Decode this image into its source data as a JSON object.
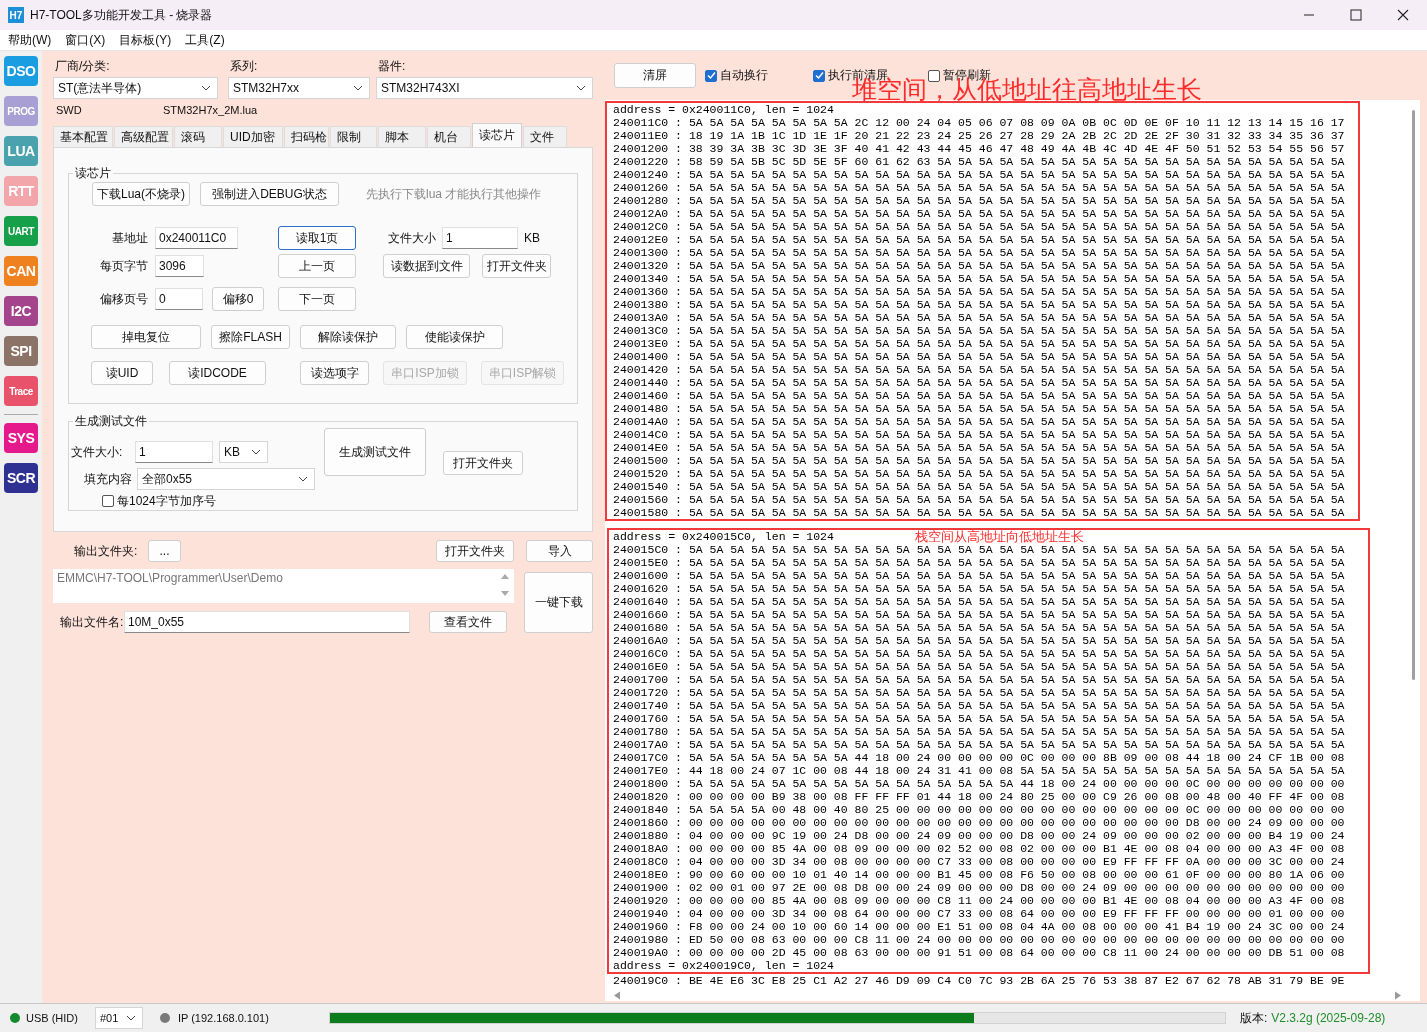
{
  "window": {
    "app_badge": "H7",
    "title": "H7-TOOL多功能开发工具 - 烧录器"
  },
  "menu": [
    "帮助(W)",
    "窗口(X)",
    "目标板(Y)",
    "工具(Z)"
  ],
  "sidebar": {
    "groups": [
      [
        {
          "label": "DSO",
          "color": "#1b9de2"
        },
        {
          "label": "PROG",
          "color": "#a89fd5"
        },
        {
          "label": "LUA",
          "color": "#49a2ae"
        },
        {
          "label": "RTT",
          "color": "#f2a6aa"
        },
        {
          "label": "UART",
          "color": "#16a049"
        },
        {
          "label": "CAN",
          "color": "#ef821f"
        },
        {
          "label": "I2C",
          "color": "#a3448d"
        },
        {
          "label": "SPI",
          "color": "#8c7367"
        },
        {
          "label": "Trace",
          "color": "#e8526a"
        }
      ],
      [
        {
          "label": "SYS",
          "color": "#e5198b"
        },
        {
          "label": "SCR",
          "color": "#2e3192"
        }
      ]
    ]
  },
  "selectors": [
    {
      "label": "厂商/分类:",
      "value": "ST(意法半导体)"
    },
    {
      "label": "系列:",
      "value": "STM32H7xx"
    },
    {
      "label": "器件:",
      "value": "STM32H743XI"
    }
  ],
  "interface": "SWD",
  "lua_file": "STM32H7x_2M.lua",
  "tabs": [
    {
      "label": "基本配置",
      "selected": false
    },
    {
      "label": "高级配置",
      "selected": false
    },
    {
      "label": "滚码",
      "selected": false
    },
    {
      "label": "UID加密",
      "selected": false
    },
    {
      "label": "扫码枪",
      "selected": false
    },
    {
      "label": "限制",
      "selected": false
    },
    {
      "label": "脚本",
      "selected": false
    },
    {
      "label": "机台",
      "selected": false
    },
    {
      "label": "读芯片",
      "selected": true
    },
    {
      "label": "文件",
      "selected": false
    }
  ],
  "read_chip": {
    "title": "读芯片",
    "top_buttons": [
      {
        "text": "下载Lua(不烧录)",
        "disabled": false,
        "focused": false
      },
      {
        "text": "强制进入DEBUG状态",
        "disabled": false,
        "focused": false
      }
    ],
    "hint": "先执行下载lua 才能执行其他操作",
    "address_fields": [
      {
        "label": "基地址",
        "value": "0x240011C0"
      },
      {
        "label": "每页字节",
        "value": "3096"
      },
      {
        "label": "偏移页号",
        "value": "0"
      }
    ],
    "offset_button": {
      "text": "偏移0",
      "disabled": false,
      "focused": false
    },
    "page_buttons": [
      {
        "text": "读取1页",
        "disabled": false,
        "focused": true
      },
      {
        "text": "上一页",
        "disabled": false,
        "focused": false
      },
      {
        "text": "下一页",
        "disabled": false,
        "focused": false
      }
    ],
    "file_size": {
      "label": "文件大小",
      "value": "1",
      "unit": "KB"
    },
    "file_buttons": [
      {
        "text": "读数据到文件",
        "disabled": false,
        "focused": false
      },
      {
        "text": "打开文件夹",
        "disabled": false,
        "focused": false
      }
    ],
    "protect_buttons": [
      {
        "text": "掉电复位",
        "disabled": false,
        "focused": false
      },
      {
        "text": "擦除FLASH",
        "disabled": false,
        "focused": false
      },
      {
        "text": "解除读保护",
        "disabled": false,
        "focused": false
      },
      {
        "text": "使能读保护",
        "disabled": false,
        "focused": false
      }
    ],
    "id_buttons": [
      {
        "text": "读UID",
        "disabled": false,
        "focused": false
      },
      {
        "text": "读IDCODE",
        "disabled": false,
        "focused": false
      },
      {
        "text": "读选项字",
        "disabled": false,
        "focused": false
      },
      {
        "text": "串口ISP加锁",
        "disabled": true,
        "focused": false
      },
      {
        "text": "串口ISP解锁",
        "disabled": true,
        "focused": false
      }
    ]
  },
  "generate": {
    "title": "生成测试文件",
    "size_label": "文件大小:",
    "size_value": "1",
    "size_unit": "KB",
    "fill_label": "填充内容",
    "fill_value": "全部0x55",
    "seq_checkbox": {
      "label": "每1024字节加序号",
      "checked": false
    },
    "generate_button": "生成测试文件",
    "open_folder_button": "打开文件夹"
  },
  "output": {
    "folder_label": "输出文件夹:",
    "browse_button": "...",
    "open_folder_button": "打开文件夹",
    "import_button": "导入",
    "path": "EMMC\\H7-TOOL\\Programmer\\User\\Demo",
    "download_button": "一键下载",
    "filename_label": "输出文件名:",
    "filename_value": "10M_0x55",
    "view_button": "查看文件"
  },
  "console_toolbar": {
    "clear_button": "清屏",
    "options": [
      {
        "label": "自动换行",
        "checked": true
      },
      {
        "label": "执行前清屏",
        "checked": true
      },
      {
        "label": "暂停刷新",
        "checked": false
      }
    ]
  },
  "hex_view": {
    "blocks": [
      {
        "note": "堆空间，从低地址往高地址生长",
        "lines": [
          "address = 0x240011C0, len = 1024",
          "240011C0 : 5A 5A 5A 5A 5A 5A 5A 5A 2C 12 00 24 04 05 06 07 08 09 0A 0B 0C 0D 0E 0F 10 11 12 13 14 15 16 17",
          "240011E0 : 18 19 1A 1B 1C 1D 1E 1F 20 21 22 23 24 25 26 27 28 29 2A 2B 2C 2D 2E 2F 30 31 32 33 34 35 36 37",
          "24001200 : 38 39 3A 3B 3C 3D 3E 3F 40 41 42 43 44 45 46 47 48 49 4A 4B 4C 4D 4E 4F 50 51 52 53 54 55 56 57",
          "24001220 : 58 59 5A 5B 5C 5D 5E 5F 60 61 62 63 5A 5A 5A 5A 5A 5A 5A 5A 5A 5A 5A 5A 5A 5A 5A 5A 5A 5A 5A 5A",
          "24001240 : 5A 5A 5A 5A 5A 5A 5A 5A 5A 5A 5A 5A 5A 5A 5A 5A 5A 5A 5A 5A 5A 5A 5A 5A 5A 5A 5A 5A 5A 5A 5A 5A",
          "24001260 : 5A 5A 5A 5A 5A 5A 5A 5A 5A 5A 5A 5A 5A 5A 5A 5A 5A 5A 5A 5A 5A 5A 5A 5A 5A 5A 5A 5A 5A 5A 5A 5A",
          "24001280 : 5A 5A 5A 5A 5A 5A 5A 5A 5A 5A 5A 5A 5A 5A 5A 5A 5A 5A 5A 5A 5A 5A 5A 5A 5A 5A 5A 5A 5A 5A 5A 5A",
          "240012A0 : 5A 5A 5A 5A 5A 5A 5A 5A 5A 5A 5A 5A 5A 5A 5A 5A 5A 5A 5A 5A 5A 5A 5A 5A 5A 5A 5A 5A 5A 5A 5A 5A",
          "240012C0 : 5A 5A 5A 5A 5A 5A 5A 5A 5A 5A 5A 5A 5A 5A 5A 5A 5A 5A 5A 5A 5A 5A 5A 5A 5A 5A 5A 5A 5A 5A 5A 5A",
          "240012E0 : 5A 5A 5A 5A 5A 5A 5A 5A 5A 5A 5A 5A 5A 5A 5A 5A 5A 5A 5A 5A 5A 5A 5A 5A 5A 5A 5A 5A 5A 5A 5A 5A",
          "24001300 : 5A 5A 5A 5A 5A 5A 5A 5A 5A 5A 5A 5A 5A 5A 5A 5A 5A 5A 5A 5A 5A 5A 5A 5A 5A 5A 5A 5A 5A 5A 5A 5A",
          "24001320 : 5A 5A 5A 5A 5A 5A 5A 5A 5A 5A 5A 5A 5A 5A 5A 5A 5A 5A 5A 5A 5A 5A 5A 5A 5A 5A 5A 5A 5A 5A 5A 5A",
          "24001340 : 5A 5A 5A 5A 5A 5A 5A 5A 5A 5A 5A 5A 5A 5A 5A 5A 5A 5A 5A 5A 5A 5A 5A 5A 5A 5A 5A 5A 5A 5A 5A 5A",
          "24001360 : 5A 5A 5A 5A 5A 5A 5A 5A 5A 5A 5A 5A 5A 5A 5A 5A 5A 5A 5A 5A 5A 5A 5A 5A 5A 5A 5A 5A 5A 5A 5A 5A",
          "24001380 : 5A 5A 5A 5A 5A 5A 5A 5A 5A 5A 5A 5A 5A 5A 5A 5A 5A 5A 5A 5A 5A 5A 5A 5A 5A 5A 5A 5A 5A 5A 5A 5A",
          "240013A0 : 5A 5A 5A 5A 5A 5A 5A 5A 5A 5A 5A 5A 5A 5A 5A 5A 5A 5A 5A 5A 5A 5A 5A 5A 5A 5A 5A 5A 5A 5A 5A 5A",
          "240013C0 : 5A 5A 5A 5A 5A 5A 5A 5A 5A 5A 5A 5A 5A 5A 5A 5A 5A 5A 5A 5A 5A 5A 5A 5A 5A 5A 5A 5A 5A 5A 5A 5A",
          "240013E0 : 5A 5A 5A 5A 5A 5A 5A 5A 5A 5A 5A 5A 5A 5A 5A 5A 5A 5A 5A 5A 5A 5A 5A 5A 5A 5A 5A 5A 5A 5A 5A 5A",
          "24001400 : 5A 5A 5A 5A 5A 5A 5A 5A 5A 5A 5A 5A 5A 5A 5A 5A 5A 5A 5A 5A 5A 5A 5A 5A 5A 5A 5A 5A 5A 5A 5A 5A",
          "24001420 : 5A 5A 5A 5A 5A 5A 5A 5A 5A 5A 5A 5A 5A 5A 5A 5A 5A 5A 5A 5A 5A 5A 5A 5A 5A 5A 5A 5A 5A 5A 5A 5A",
          "24001440 : 5A 5A 5A 5A 5A 5A 5A 5A 5A 5A 5A 5A 5A 5A 5A 5A 5A 5A 5A 5A 5A 5A 5A 5A 5A 5A 5A 5A 5A 5A 5A 5A",
          "24001460 : 5A 5A 5A 5A 5A 5A 5A 5A 5A 5A 5A 5A 5A 5A 5A 5A 5A 5A 5A 5A 5A 5A 5A 5A 5A 5A 5A 5A 5A 5A 5A 5A",
          "24001480 : 5A 5A 5A 5A 5A 5A 5A 5A 5A 5A 5A 5A 5A 5A 5A 5A 5A 5A 5A 5A 5A 5A 5A 5A 5A 5A 5A 5A 5A 5A 5A 5A",
          "240014A0 : 5A 5A 5A 5A 5A 5A 5A 5A 5A 5A 5A 5A 5A 5A 5A 5A 5A 5A 5A 5A 5A 5A 5A 5A 5A 5A 5A 5A 5A 5A 5A 5A",
          "240014C0 : 5A 5A 5A 5A 5A 5A 5A 5A 5A 5A 5A 5A 5A 5A 5A 5A 5A 5A 5A 5A 5A 5A 5A 5A 5A 5A 5A 5A 5A 5A 5A 5A",
          "240014E0 : 5A 5A 5A 5A 5A 5A 5A 5A 5A 5A 5A 5A 5A 5A 5A 5A 5A 5A 5A 5A 5A 5A 5A 5A 5A 5A 5A 5A 5A 5A 5A 5A",
          "24001500 : 5A 5A 5A 5A 5A 5A 5A 5A 5A 5A 5A 5A 5A 5A 5A 5A 5A 5A 5A 5A 5A 5A 5A 5A 5A 5A 5A 5A 5A 5A 5A 5A",
          "24001520 : 5A 5A 5A 5A 5A 5A 5A 5A 5A 5A 5A 5A 5A 5A 5A 5A 5A 5A 5A 5A 5A 5A 5A 5A 5A 5A 5A 5A 5A 5A 5A 5A",
          "24001540 : 5A 5A 5A 5A 5A 5A 5A 5A 5A 5A 5A 5A 5A 5A 5A 5A 5A 5A 5A 5A 5A 5A 5A 5A 5A 5A 5A 5A 5A 5A 5A 5A",
          "24001560 : 5A 5A 5A 5A 5A 5A 5A 5A 5A 5A 5A 5A 5A 5A 5A 5A 5A 5A 5A 5A 5A 5A 5A 5A 5A 5A 5A 5A 5A 5A 5A 5A",
          "24001580 : 5A 5A 5A 5A 5A 5A 5A 5A 5A 5A 5A 5A 5A 5A 5A 5A 5A 5A 5A 5A 5A 5A 5A 5A 5A 5A 5A 5A 5A 5A 5A 5A"
        ]
      },
      {
        "note": "栈空间从高地址向低地址生长",
        "lines": [
          "address = 0x240015C0, len = 1024",
          "240015C0 : 5A 5A 5A 5A 5A 5A 5A 5A 5A 5A 5A 5A 5A 5A 5A 5A 5A 5A 5A 5A 5A 5A 5A 5A 5A 5A 5A 5A 5A 5A 5A 5A",
          "240015E0 : 5A 5A 5A 5A 5A 5A 5A 5A 5A 5A 5A 5A 5A 5A 5A 5A 5A 5A 5A 5A 5A 5A 5A 5A 5A 5A 5A 5A 5A 5A 5A 5A",
          "24001600 : 5A 5A 5A 5A 5A 5A 5A 5A 5A 5A 5A 5A 5A 5A 5A 5A 5A 5A 5A 5A 5A 5A 5A 5A 5A 5A 5A 5A 5A 5A 5A 5A",
          "24001620 : 5A 5A 5A 5A 5A 5A 5A 5A 5A 5A 5A 5A 5A 5A 5A 5A 5A 5A 5A 5A 5A 5A 5A 5A 5A 5A 5A 5A 5A 5A 5A 5A",
          "24001640 : 5A 5A 5A 5A 5A 5A 5A 5A 5A 5A 5A 5A 5A 5A 5A 5A 5A 5A 5A 5A 5A 5A 5A 5A 5A 5A 5A 5A 5A 5A 5A 5A",
          "24001660 : 5A 5A 5A 5A 5A 5A 5A 5A 5A 5A 5A 5A 5A 5A 5A 5A 5A 5A 5A 5A 5A 5A 5A 5A 5A 5A 5A 5A 5A 5A 5A 5A",
          "24001680 : 5A 5A 5A 5A 5A 5A 5A 5A 5A 5A 5A 5A 5A 5A 5A 5A 5A 5A 5A 5A 5A 5A 5A 5A 5A 5A 5A 5A 5A 5A 5A 5A",
          "240016A0 : 5A 5A 5A 5A 5A 5A 5A 5A 5A 5A 5A 5A 5A 5A 5A 5A 5A 5A 5A 5A 5A 5A 5A 5A 5A 5A 5A 5A 5A 5A 5A 5A",
          "240016C0 : 5A 5A 5A 5A 5A 5A 5A 5A 5A 5A 5A 5A 5A 5A 5A 5A 5A 5A 5A 5A 5A 5A 5A 5A 5A 5A 5A 5A 5A 5A 5A 5A",
          "240016E0 : 5A 5A 5A 5A 5A 5A 5A 5A 5A 5A 5A 5A 5A 5A 5A 5A 5A 5A 5A 5A 5A 5A 5A 5A 5A 5A 5A 5A 5A 5A 5A 5A",
          "24001700 : 5A 5A 5A 5A 5A 5A 5A 5A 5A 5A 5A 5A 5A 5A 5A 5A 5A 5A 5A 5A 5A 5A 5A 5A 5A 5A 5A 5A 5A 5A 5A 5A",
          "24001720 : 5A 5A 5A 5A 5A 5A 5A 5A 5A 5A 5A 5A 5A 5A 5A 5A 5A 5A 5A 5A 5A 5A 5A 5A 5A 5A 5A 5A 5A 5A 5A 5A",
          "24001740 : 5A 5A 5A 5A 5A 5A 5A 5A 5A 5A 5A 5A 5A 5A 5A 5A 5A 5A 5A 5A 5A 5A 5A 5A 5A 5A 5A 5A 5A 5A 5A 5A",
          "24001760 : 5A 5A 5A 5A 5A 5A 5A 5A 5A 5A 5A 5A 5A 5A 5A 5A 5A 5A 5A 5A 5A 5A 5A 5A 5A 5A 5A 5A 5A 5A 5A 5A",
          "24001780 : 5A 5A 5A 5A 5A 5A 5A 5A 5A 5A 5A 5A 5A 5A 5A 5A 5A 5A 5A 5A 5A 5A 5A 5A 5A 5A 5A 5A 5A 5A 5A 5A",
          "240017A0 : 5A 5A 5A 5A 5A 5A 5A 5A 5A 5A 5A 5A 5A 5A 5A 5A 5A 5A 5A 5A 5A 5A 5A 5A 5A 5A 5A 5A 5A 5A 5A 5A",
          "240017C0 : 5A 5A 5A 5A 5A 5A 5A 5A 44 18 00 24 00 00 00 00 0C 00 00 00 8B 09 00 08 44 18 00 24 CF 1B 00 08",
          "240017E0 : 44 18 00 24 07 1C 00 08 44 18 00 24 31 41 00 08 5A 5A 5A 5A 5A 5A 5A 5A 5A 5A 5A 5A 5A 5A 5A 5A",
          "24001800 : 5A 5A 5A 5A 5A 5A 5A 5A 5A 5A 5A 5A 5A 5A 5A 5A 44 18 00 24 00 00 00 00 0C 00 00 00 00 00 00 00",
          "24001820 : 00 00 00 00 B9 38 00 08 FF FF FF 01 44 18 00 24 80 25 00 00 C9 26 00 08 00 48 00 40 FF 4F 00 08",
          "24001840 : 5A 5A 5A 5A 00 48 00 40 80 25 00 00 00 00 00 00 00 00 00 00 00 00 00 00 0C 00 00 00 00 00 00 00",
          "24001860 : 00 00 00 00 00 00 00 00 00 00 00 00 00 00 00 00 00 00 00 00 00 00 00 00 D8 00 00 24 09 00 00 00",
          "24001880 : 04 00 00 00 9C 19 00 24 D8 00 00 24 09 00 00 00 D8 00 00 24 09 00 00 00 02 00 00 00 B4 19 00 24",
          "240018A0 : 00 00 00 00 85 4A 00 08 09 00 00 00 02 52 00 08 02 00 00 00 B1 4E 00 08 04 00 00 00 A3 4F 00 08",
          "240018C0 : 04 00 00 00 3D 34 00 08 00 00 00 00 C7 33 00 08 00 00 00 00 E9 FF FF FF 0A 00 00 00 3C 00 00 24",
          "240018E0 : 90 00 60 00 00 10 01 40 14 00 00 00 B1 45 00 08 F6 50 00 08 00 00 00 61 0F 00 00 00 80 1A 06 00",
          "24001900 : 02 00 01 00 97 2E 00 08 D8 00 00 24 09 00 00 00 D8 00 00 24 09 00 00 00 00 00 00 00 00 00 00 00",
          "24001920 : 00 00 00 00 85 4A 00 08 09 00 00 00 C8 11 00 24 00 00 00 00 B1 4E 00 08 04 00 00 00 A3 4F 00 08",
          "24001940 : 04 00 00 00 3D 34 00 08 64 00 00 00 C7 33 00 08 64 00 00 00 E9 FF FF FF 00 00 00 00 01 00 00 00",
          "24001960 : F8 00 00 24 00 10 00 60 14 00 00 00 E1 51 00 08 04 4A 00 08 00 00 00 41 B4 19 00 24 3C 00 00 24",
          "24001980 : ED 50 00 08 63 00 00 00 C8 11 00 24 00 00 00 00 00 00 00 00 00 00 00 00 00 00 00 00 00 00 00 00",
          "240019A0 : 00 00 00 00 2D 45 00 08 63 00 00 00 91 51 00 08 64 00 00 00 C8 11 00 24 00 00 00 00 DB 51 00 08",
          "address = 0x240019C0, len = 1024"
        ]
      }
    ],
    "after_lines": [
      "240019C0 : BE 4E E6 3C E8 25 C1 A2 27 46 D9 09 C4 C0 7C 93 2B 6A 25 76 53 38 87 E2 67 62 78 AB 31 79 BE 9E"
    ]
  },
  "status_bar": {
    "usb": {
      "label": "USB (HID)",
      "color": "#138a2e"
    },
    "device": "#01",
    "ip": {
      "label": "IP (192.168.0.101)",
      "color": "#7a7a7a"
    },
    "progress": {
      "level": 0.72
    },
    "version_label": "版本:",
    "version": "V2.3.2g (2025-09-28)"
  }
}
